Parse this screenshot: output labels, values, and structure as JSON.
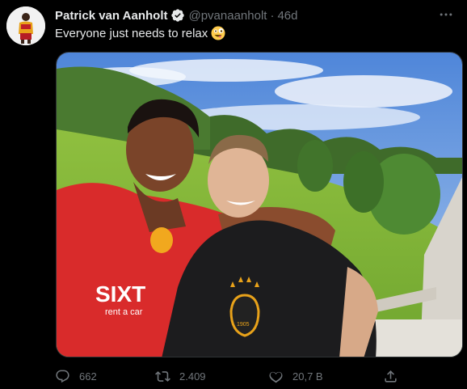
{
  "author": {
    "display_name": "Patrick van Aanholt",
    "handle": "@pvanaanholt",
    "separator": "·",
    "time": "46d",
    "verified": true
  },
  "tweet": {
    "text": "Everyone just needs to relax",
    "emoji": "zany-face-emoji"
  },
  "media": {
    "jersey_sponsor": "SIXT",
    "jersey_sponsor_sub": "rent a car",
    "crest_year": "1905"
  },
  "actions": {
    "replies": "662",
    "retweets": "2.409",
    "likes": "20,7 B"
  },
  "colors": {
    "background": "#000000",
    "primary_text": "#e7e9ea",
    "secondary_text": "#71767b",
    "verified_blue": "#1d9bf0",
    "jersey_red": "#d92b2b"
  }
}
